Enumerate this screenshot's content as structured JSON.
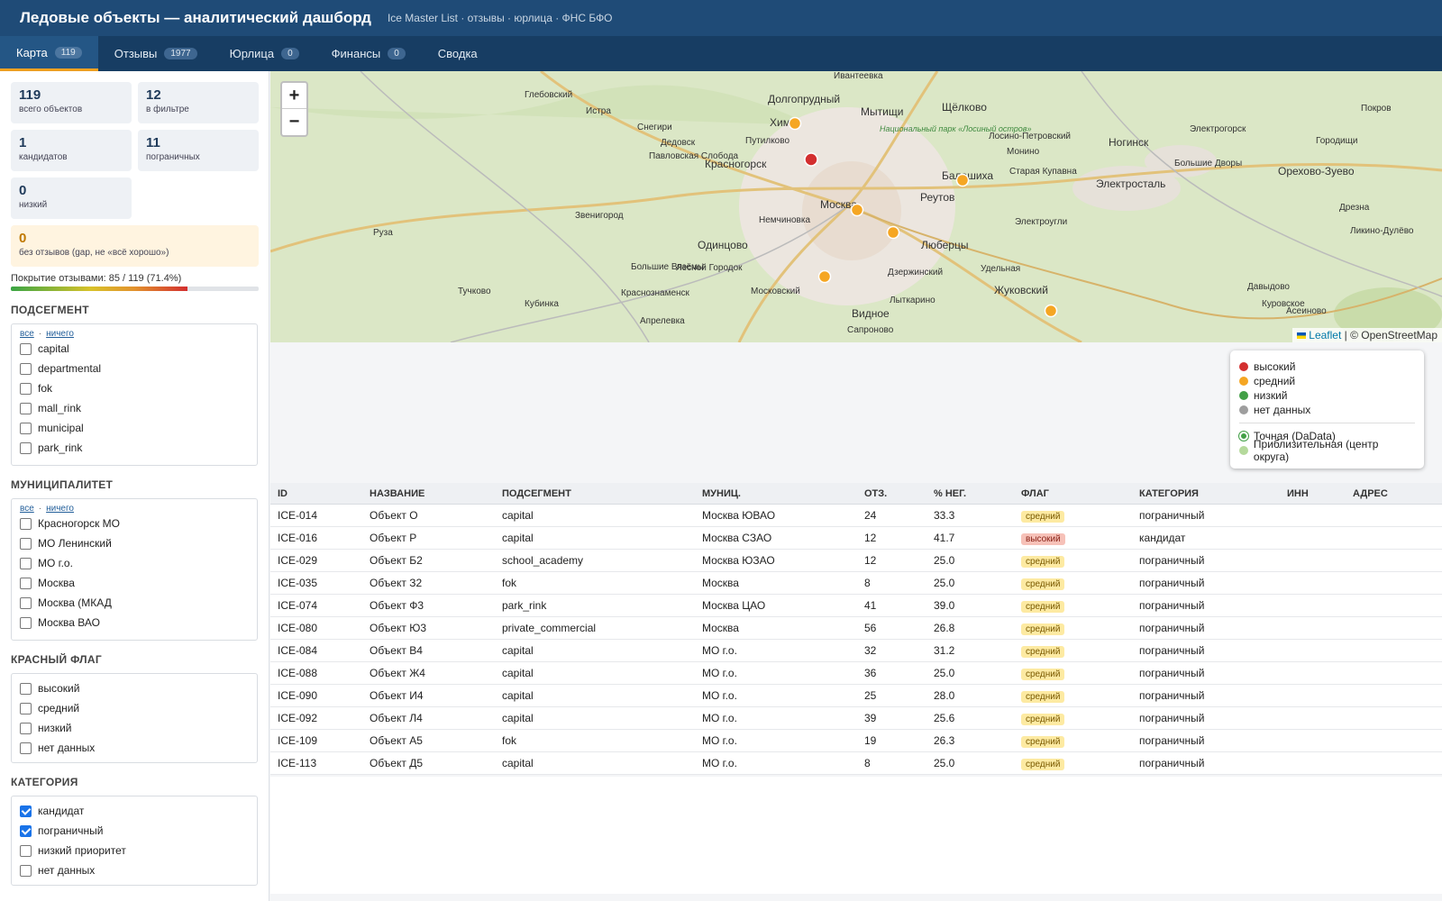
{
  "header": {
    "title": "Ледовые объекты — аналитический дашборд",
    "subtitle": "Ice Master List · отзывы · юрлица · ФНС БФО"
  },
  "tabs": [
    {
      "label": "Карта",
      "count": "119"
    },
    {
      "label": "Отзывы",
      "count": "1977"
    },
    {
      "label": "Юрлица",
      "count": "0"
    },
    {
      "label": "Финансы",
      "count": "0"
    },
    {
      "label": "Сводка",
      "count": ""
    }
  ],
  "stats": {
    "total": {
      "num": "119",
      "label": "всего объектов"
    },
    "filtered": {
      "num": "12",
      "label": "в фильтре"
    },
    "candidates": {
      "num": "1",
      "label": "кандидатов"
    },
    "borderline": {
      "num": "11",
      "label": "пограничных"
    },
    "low": {
      "num": "0",
      "label": "низкий"
    },
    "no_reviews": {
      "num": "0",
      "label": "без отзывов (gap, не «всё хорошо»)"
    }
  },
  "coverage": {
    "text": "Покрытие отзывами: 85 / 119 (71.4%)",
    "percent": 71.4
  },
  "filters": {
    "all_link": "все",
    "none_link": "ничего",
    "subsegment": {
      "title": "ПОДСЕГМЕНТ",
      "items": [
        "capital",
        "departmental",
        "fok",
        "mall_rink",
        "municipal",
        "park_rink"
      ]
    },
    "municipality": {
      "title": "МУНИЦИПАЛИТЕТ",
      "items": [
        "Красногорск МО",
        "МО Ленинский",
        "МО г.о.",
        "Москва",
        "Москва (МКАД",
        "Москва ВАО"
      ]
    },
    "redflag": {
      "title": "КРАСНЫЙ ФЛАГ",
      "items": [
        "высокий",
        "средний",
        "низкий",
        "нет данных"
      ]
    },
    "category": {
      "title": "КАТЕГОРИЯ",
      "items": [
        "кандидат",
        "пограничный",
        "низкий приоритет",
        "нет данных"
      ],
      "checked": [
        true,
        true,
        false,
        false
      ]
    }
  },
  "map": {
    "zoom_in": "+",
    "zoom_out": "−",
    "attribution_leaflet": "Leaflet",
    "attribution_rest": "| © OpenStreetMap",
    "labels": [
      "Ивантеевка",
      "Глебовский",
      "Долгопрудный",
      "Мытищи",
      "Щёлково",
      "Покров",
      "Истра",
      "Химки",
      "Снегири",
      "Национальный парк «Лосиный остров»",
      "Лосино-Петровский",
      "Ногинск",
      "Электрогорск",
      "Городищи",
      "Дедовск",
      "Путилково",
      "Монино",
      "Павловская Слобода",
      "Красногорск",
      "Балашиха",
      "Старая Купавна",
      "Большие Дворы",
      "Орехово-Зуево",
      "Электросталь",
      "Звенигород",
      "Москва",
      "Реутов",
      "Дрезна",
      "Немчиновка",
      "Электроугли",
      "Ликино-Дулёво",
      "Руза",
      "Одинцово",
      "Люберцы",
      "Большие Вязёмы",
      "Лесной Городок",
      "Дзержинский",
      "Удельная",
      "Тучково",
      "Краснознаменск",
      "Жуковский",
      "Давыдово",
      "Кубинка",
      "Московский",
      "Лыткарино",
      "Куровское",
      "Апрелевка",
      "Видное",
      "Асеиново",
      "Сапроново"
    ]
  },
  "legend": {
    "items": [
      {
        "label": "высокий",
        "color": "#d32f2f"
      },
      {
        "label": "средний",
        "color": "#f5a623"
      },
      {
        "label": "низкий",
        "color": "#43a047"
      },
      {
        "label": "нет данных",
        "color": "#9e9e9e"
      }
    ],
    "precision": [
      {
        "label": "Точная (DaData)",
        "color": "#43a047"
      },
      {
        "label": "Приблизительная (центр округа)",
        "color": "#b5d99c"
      }
    ]
  },
  "table": {
    "columns": [
      "ID",
      "НАЗВАНИЕ",
      "ПОДСЕГМЕНТ",
      "МУНИЦ.",
      "ОТЗ.",
      "% НЕГ.",
      "ФЛАГ",
      "КАТЕГОРИЯ",
      "ИНН",
      "АДРЕС"
    ],
    "rows": [
      [
        "ICE-014",
        "Объект О",
        "capital",
        "Москва ЮВАО",
        "24",
        "33.3",
        "средний",
        "пограничный",
        "",
        ""
      ],
      [
        "ICE-016",
        "Объект Р",
        "capital",
        "Москва СЗАО",
        "12",
        "41.7",
        "высокий",
        "кандидат",
        "",
        ""
      ],
      [
        "ICE-029",
        "Объект Б2",
        "school_academy",
        "Москва ЮЗАО",
        "12",
        "25.0",
        "средний",
        "пограничный",
        "",
        ""
      ],
      [
        "ICE-035",
        "Объект З2",
        "fok",
        "Москва",
        "8",
        "25.0",
        "средний",
        "пограничный",
        "",
        ""
      ],
      [
        "ICE-074",
        "Объект Ф3",
        "park_rink",
        "Москва ЦАО",
        "41",
        "39.0",
        "средний",
        "пограничный",
        "",
        ""
      ],
      [
        "ICE-080",
        "Объект Ю3",
        "private_commercial",
        "Москва",
        "56",
        "26.8",
        "средний",
        "пограничный",
        "",
        ""
      ],
      [
        "ICE-084",
        "Объект В4",
        "capital",
        "МО г.о.",
        "32",
        "31.2",
        "средний",
        "пограничный",
        "",
        ""
      ],
      [
        "ICE-088",
        "Объект Ж4",
        "capital",
        "МО г.о.",
        "36",
        "25.0",
        "средний",
        "пограничный",
        "",
        ""
      ],
      [
        "ICE-090",
        "Объект И4",
        "capital",
        "МО г.о.",
        "25",
        "28.0",
        "средний",
        "пограничный",
        "",
        ""
      ],
      [
        "ICE-092",
        "Объект Л4",
        "capital",
        "МО г.о.",
        "39",
        "25.6",
        "средний",
        "пограничный",
        "",
        ""
      ],
      [
        "ICE-109",
        "Объект А5",
        "fok",
        "МО г.о.",
        "19",
        "26.3",
        "средний",
        "пограничный",
        "",
        ""
      ],
      [
        "ICE-113",
        "Объект Д5",
        "capital",
        "МО г.о.",
        "8",
        "25.0",
        "средний",
        "пограничный",
        "",
        ""
      ]
    ]
  }
}
